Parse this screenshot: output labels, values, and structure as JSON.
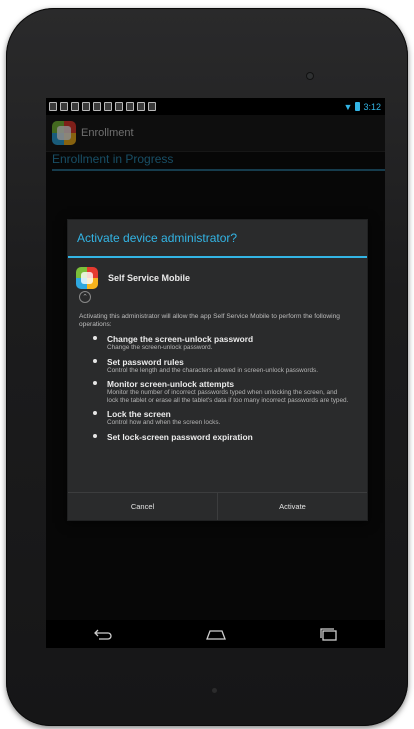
{
  "statusbar": {
    "notification_icons": [
      "sim-icon",
      "image-icon",
      "download-icon",
      "download-icon",
      "mail-icon",
      "cloud-icon",
      "chat-icon",
      "check-icon",
      "check-icon",
      "camera-icon"
    ],
    "time": "3:12",
    "accent": "#33b5e5"
  },
  "actionbar": {
    "title": "Enrollment"
  },
  "progress": {
    "title": "Enrollment in Progress"
  },
  "dialog": {
    "title": "Activate device administrator?",
    "app_name": "Self Service Mobile",
    "intro": "Activating this administrator will allow the app Self Service Mobile to perform the following operations:",
    "permissions": [
      {
        "title": "Change the screen-unlock password",
        "desc": "Change the screen-unlock password."
      },
      {
        "title": "Set password rules",
        "desc": "Control the length and the characters allowed in screen-unlock passwords."
      },
      {
        "title": "Monitor screen-unlock attempts",
        "desc": "Monitor the number of incorrect passwords typed when unlocking the screen, and lock the tablet or erase all the tablet's data if too many incorrect passwords are typed."
      },
      {
        "title": "Lock the screen",
        "desc": "Control how and when the screen locks."
      },
      {
        "title": "Set lock-screen password expiration",
        "desc": ""
      }
    ],
    "cancel_label": "Cancel",
    "activate_label": "Activate"
  },
  "navbar": {
    "icons": [
      "back-icon",
      "home-icon",
      "recents-icon"
    ]
  }
}
